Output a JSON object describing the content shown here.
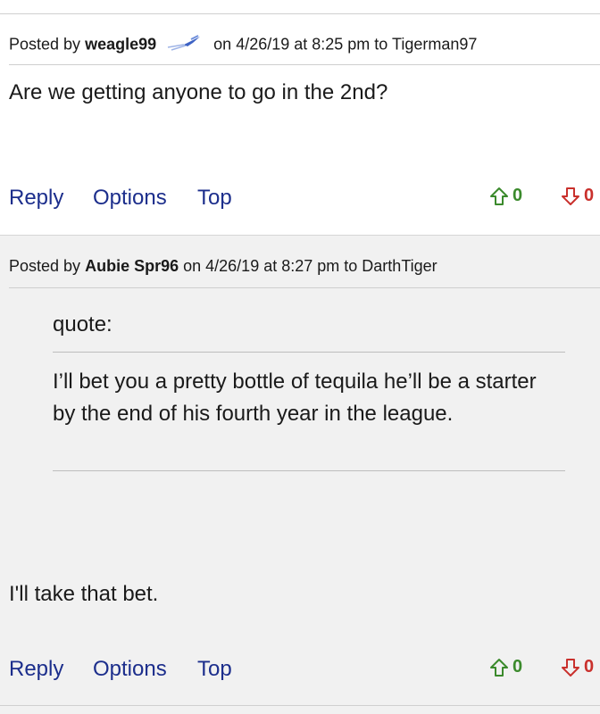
{
  "posts": [
    {
      "posted_by_label": "Posted by",
      "username": "weagle99",
      "meta": "on 4/26/19 at 8:25 pm to",
      "reply_to": "Tigerman97",
      "body": "Are we getting anyone to go in the 2nd?",
      "actions": {
        "reply": "Reply",
        "options": "Options",
        "top": "Top"
      },
      "upvotes": "0",
      "downvotes": "0"
    },
    {
      "posted_by_label": "Posted by",
      "username": "Aubie Spr96",
      "meta": "on 4/26/19 at 8:27 pm to",
      "reply_to": "DarthTiger",
      "quote_label": "quote:",
      "quote": "I’ll bet you a pretty bottle of tequila he’ll be a starter by the end of his fourth year in the league.",
      "body": "I'll take that bet.",
      "actions": {
        "reply": "Reply",
        "options": "Options",
        "top": "Top"
      },
      "upvotes": "0",
      "downvotes": "0"
    }
  ],
  "icons": {
    "badge": "shooting-star-badge-icon",
    "up": "arrow-up-icon",
    "down": "arrow-down-icon"
  },
  "colors": {
    "link": "#1c2e8c",
    "upvote": "#3b8a2c",
    "downvote": "#c9302c"
  }
}
